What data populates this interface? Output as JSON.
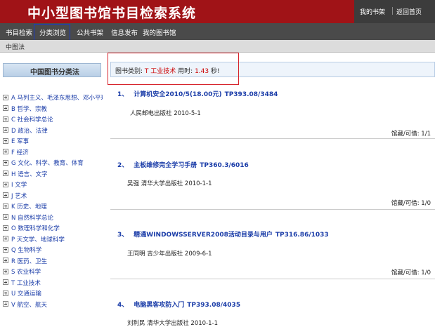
{
  "header": {
    "title": "中小型图书馆书目检索系统",
    "links": [
      "我的书架",
      "返回首页"
    ]
  },
  "nav": {
    "items": [
      "书目检索",
      "分类浏览",
      "公共书架",
      "信息发布",
      "我的图书馆"
    ],
    "active": "分类浏览"
  },
  "subbar": {
    "label": "中图法"
  },
  "sidebar": {
    "heading": "中国图书分类法",
    "items": [
      "A 马列主义、毛泽东思想、邓小平理论",
      "B 哲学、宗教",
      "C 社会科学总论",
      "D 政治、法律",
      "E 军事",
      "F 经济",
      "G 文化、科学、教育、体育",
      "H 语言、文字",
      "I 文学",
      "J 艺术",
      "K 历史、地理",
      "N 自然科学总论",
      "O 数理科学和化学",
      "P 天文学、地球科学",
      "Q 生物科学",
      "R 医药、卫生",
      "S 农业科学",
      "T 工业技术",
      "U 交通运输",
      "V 航空、航天"
    ]
  },
  "info": {
    "category_label": "图书类别:",
    "category_value": "T 工业技术",
    "time_label": "用时:",
    "time_value": "1.43",
    "time_unit": "秒!"
  },
  "results": [
    {
      "num": "1、",
      "title": "计算机安全2010/5(18.00元)",
      "call": "TP393.08/3484",
      "pub": "人民邮电出版社 2010-5-1",
      "hold": "馆藏/可借: 1/1"
    },
    {
      "num": "2、",
      "title": "主板维修完全学习手册",
      "call": "TP360.3/6016",
      "pub": "吴强 清华大学出版社 2010-1-1",
      "hold": "馆藏/可借: 1/0"
    },
    {
      "num": "3、",
      "title": "精通WINDOWSSERVER2008活动目录与用户",
      "call": "TP316.86/1033",
      "pub": "王同明 吉少年出版社 2009-6-1",
      "hold": "馆藏/可借: 1/0"
    },
    {
      "num": "4、",
      "title": "电脑黑客攻防入门",
      "call": "TP393.08/4035",
      "pub": "刘利民 清华大学出版社 2010-1-1",
      "hold": ""
    }
  ],
  "colors": {
    "header_bg": "#a01317",
    "nav_bg": "#4a4a4a",
    "link": "#1a3ca8",
    "highlight_red": "#c00"
  }
}
